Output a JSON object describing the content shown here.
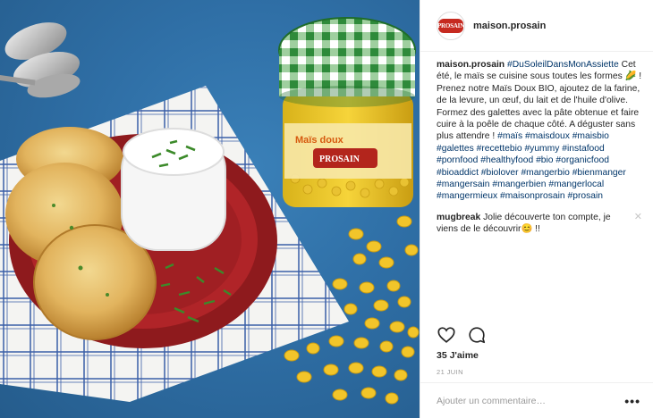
{
  "account": {
    "avatar_text": "PROSAIN",
    "username": "maison.prosain"
  },
  "jar_label": {
    "product": "Maïs doux",
    "brand": "PROSAIN"
  },
  "caption": {
    "username": "maison.prosain",
    "title_tag": "#DuSoleilDansMonAssiette",
    "text_1": " Cet été, le maïs se cuisine sous toutes les formes ",
    "emoji_corn": "🌽",
    "text_2": " ! Prenez notre Maïs Doux BIO, ajoutez de la farine, de la levure, un œuf, du lait et de l'huile d'olive. Formez des galettes avec la pâte obtenue et faire cuire à la poêle de chaque côté. A déguster sans plus attendre !",
    "hashtags": "#maïs #maisdoux #maisbio #galettes #recettebio #yummy #instafood #pornfood #healthyfood #bio #organicfood #bioaddict #biolover #mangerbio #bienmanger #mangersain #mangerbien #mangerlocal #mangermieux #maisonprosain #prosain"
  },
  "comment": {
    "username": "mugbreak",
    "text": " Jolie découverte ton compte, je viens de le découvrir",
    "emoji": "😊",
    "suffix": " !!",
    "close": "✕"
  },
  "icons": {
    "like": "heart-icon",
    "comment": "comment-bubble-icon",
    "more": "more-options-icon"
  },
  "likes_text": "35 J'aime",
  "date_text": "21 JUIN",
  "add_comment": {
    "placeholder": "Ajouter un commentaire…",
    "more_label": "•••"
  },
  "colors": {
    "background_blue": "#2f6fa6",
    "hashtag_blue": "#003569",
    "brand_red": "#c62a20",
    "gingham_green": "#2e8a3a"
  }
}
